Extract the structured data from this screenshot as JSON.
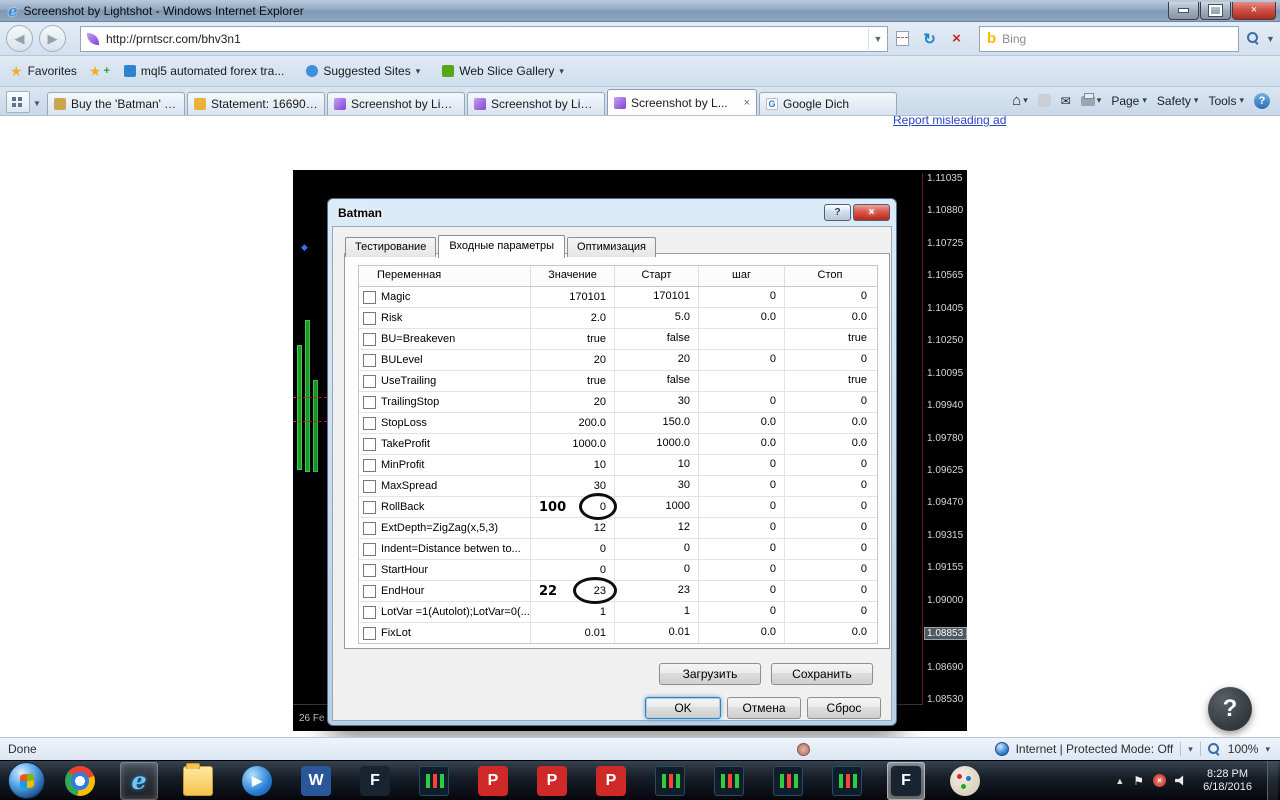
{
  "window": {
    "title": "Screenshot by Lightshot - Windows Internet Explorer"
  },
  "navigation": {
    "url": "http://prntscr.com/bhv3n1",
    "search_provider": "Bing"
  },
  "favorites_bar": {
    "favorites_label": "Favorites",
    "links": [
      {
        "label": "mql5 automated forex tra...",
        "dropdown": false
      },
      {
        "label": "Suggested Sites",
        "dropdown": true
      },
      {
        "label": "Web Slice Gallery",
        "dropdown": true
      }
    ]
  },
  "tab_bar": {
    "tabs": [
      {
        "label": "Buy the 'Batman' T...",
        "icon": "cart",
        "active": false,
        "closable": false
      },
      {
        "label": "Statement: 166900 ...",
        "icon": "statement",
        "active": false,
        "closable": false
      },
      {
        "label": "Screenshot by Ligh...",
        "icon": "feather",
        "active": false,
        "closable": false
      },
      {
        "label": "Screenshot by Ligh...",
        "icon": "feather",
        "active": false,
        "closable": false
      },
      {
        "label": "Screenshot by L...",
        "icon": "feather",
        "active": true,
        "closable": true
      },
      {
        "label": "Google Dich",
        "icon": "google",
        "active": false,
        "closable": false
      }
    ],
    "menus": {
      "page": "Page",
      "safety": "Safety",
      "tools": "Tools"
    }
  },
  "page": {
    "report_ad_link": "Report misleading ad"
  },
  "chart": {
    "date_label": "26 Fe",
    "current_price": "1.08853",
    "price_scale": [
      "1.11035",
      "1.10880",
      "1.10725",
      "1.10565",
      "1.10405",
      "1.10250",
      "1.10095",
      "1.09940",
      "1.09780",
      "1.09625",
      "1.09470",
      "1.09315",
      "1.09155",
      "1.09000",
      "1.08853",
      "1.08690",
      "1.08530"
    ]
  },
  "dialog": {
    "title": "Batman",
    "tabs": [
      {
        "label": "Тестирование",
        "active": false
      },
      {
        "label": "Входные параметры",
        "active": true
      },
      {
        "label": "Оптимизация",
        "active": false
      }
    ],
    "table": {
      "headers": [
        "Переменная",
        "Значение",
        "Старт",
        "шаг",
        "Стоп"
      ],
      "rows": [
        {
          "name": "Magic",
          "value": "170101",
          "start": "170101",
          "step": "0",
          "stop": "0"
        },
        {
          "name": "Risk",
          "value": "2.0",
          "start": "5.0",
          "step": "0.0",
          "stop": "0.0"
        },
        {
          "name": "BU=Breakeven",
          "value": "true",
          "start": "false",
          "step": "",
          "stop": "true"
        },
        {
          "name": "BULevel",
          "value": "20",
          "start": "20",
          "step": "0",
          "stop": "0"
        },
        {
          "name": "UseTrailing",
          "value": "true",
          "start": "false",
          "step": "",
          "stop": "true"
        },
        {
          "name": "TrailingStop",
          "value": "20",
          "start": "30",
          "step": "0",
          "stop": "0"
        },
        {
          "name": "StopLoss",
          "value": "200.0",
          "start": "150.0",
          "step": "0.0",
          "stop": "0.0"
        },
        {
          "name": "TakeProfit",
          "value": "1000.0",
          "start": "1000.0",
          "step": "0.0",
          "stop": "0.0"
        },
        {
          "name": "MinProfit",
          "value": "10",
          "start": "10",
          "step": "0",
          "stop": "0"
        },
        {
          "name": "MaxSpread",
          "value": "30",
          "start": "30",
          "step": "0",
          "stop": "0"
        },
        {
          "name": "RollBack",
          "value": "0",
          "start": "1000",
          "step": "0",
          "stop": "0",
          "annotation": "100",
          "circled": true
        },
        {
          "name": "ExtDepth=ZigZag(x,5,3)",
          "value": "12",
          "start": "12",
          "step": "0",
          "stop": "0"
        },
        {
          "name": "Indent=Distance betwen to...",
          "value": "0",
          "start": "0",
          "step": "0",
          "stop": "0"
        },
        {
          "name": "StartHour",
          "value": "0",
          "start": "0",
          "step": "0",
          "stop": "0"
        },
        {
          "name": "EndHour",
          "value": "23",
          "start": "23",
          "step": "0",
          "stop": "0",
          "annotation": "22",
          "circled": true
        },
        {
          "name": "LotVar =1(Autolot);LotVar=0(...",
          "value": "1",
          "start": "1",
          "step": "0",
          "stop": "0"
        },
        {
          "name": "FixLot",
          "value": "0.01",
          "start": "0.01",
          "step": "0.0",
          "stop": "0.0"
        }
      ]
    },
    "buttons": {
      "load": "Загрузить",
      "save": "Сохранить",
      "ok": "OK",
      "cancel": "Отмена",
      "reset": "Сброс"
    }
  },
  "status_bar": {
    "status": "Done",
    "zone": "Internet | Protected Mode: Off",
    "zoom": "100%"
  },
  "taskbar": {
    "clock": {
      "time": "8:28 PM",
      "date": "6/18/2016"
    },
    "icons": [
      {
        "name": "chrome"
      },
      {
        "name": "internet-explorer",
        "glyph": "e",
        "running": true
      },
      {
        "name": "windows-explorer"
      },
      {
        "name": "media-player",
        "glyph": "▶"
      },
      {
        "name": "word",
        "glyph": "W",
        "bg": "#2b579a"
      },
      {
        "name": "fxpro",
        "glyph": "F",
        "bg": "#1a2330"
      },
      {
        "name": "mt4-1"
      },
      {
        "name": "presentation-p1",
        "glyph": "P",
        "bg": "#cf2a27"
      },
      {
        "name": "presentation-p2",
        "glyph": "P",
        "bg": "#cf2a27"
      },
      {
        "name": "presentation-p3",
        "glyph": "P",
        "bg": "#cf2a27"
      },
      {
        "name": "mt4-2"
      },
      {
        "name": "mt4-3"
      },
      {
        "name": "mt4-4"
      },
      {
        "name": "mt4-5"
      },
      {
        "name": "fxpro-active",
        "glyph": "F",
        "bg": "#1a2330",
        "active": true
      },
      {
        "name": "paint"
      }
    ]
  }
}
